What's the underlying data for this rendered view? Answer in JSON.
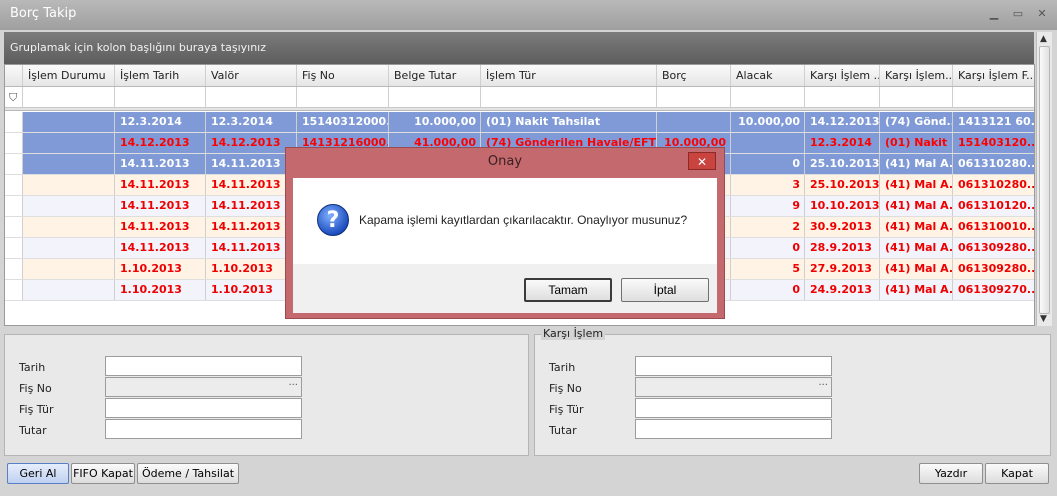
{
  "window": {
    "title": "Borç Takip"
  },
  "grid": {
    "group_hint": "Gruplamak için kolon başlığını buraya taşıyınız",
    "columns": [
      "İşlem Durumu",
      "İşlem Tarih",
      "Valör",
      "Fiş No",
      "Belge Tutar",
      "İşlem Tür",
      "Borç",
      "Alacak",
      "Karşı İşlem ...",
      "Karşı İşlem...",
      "Karşı İşlem F..."
    ],
    "row_indicator": "›",
    "rows": [
      [
        "",
        "12.3.2014",
        "12.3.2014",
        "15140312000...",
        "10.000,00",
        "(01) Nakit Tahsilat",
        "",
        "10.000,00",
        "14.12.2013",
        "(74) Gönd...",
        "1413121 60..."
      ],
      [
        "",
        "14.12.2013",
        "14.12.2013",
        "14131216000...",
        "41.000,00",
        "(74) Gönderilen Havale/EFT",
        "10.000,00",
        "",
        "12.3.2014",
        "(01) Nakit ...",
        "151403120..."
      ],
      [
        "",
        "14.11.2013",
        "14.11.2013",
        "",
        "",
        "",
        "",
        "0",
        "25.10.2013",
        "(41) Mal A...",
        "061310280..."
      ],
      [
        "",
        "14.11.2013",
        "14.11.2013",
        "",
        "",
        "",
        "",
        "3",
        "25.10.2013",
        "(41) Mal A...",
        "061310280..."
      ],
      [
        "",
        "14.11.2013",
        "14.11.2013",
        "",
        "",
        "",
        "",
        "9",
        "10.10.2013",
        "(41) Mal A...",
        "061310120..."
      ],
      [
        "",
        "14.11.2013",
        "14.11.2013",
        "",
        "",
        "",
        "",
        "2",
        "30.9.2013",
        "(41) Mal A...",
        "061310010..."
      ],
      [
        "",
        "14.11.2013",
        "14.11.2013",
        "",
        "",
        "",
        "",
        "0",
        "28.9.2013",
        "(41) Mal A...",
        "061309280..."
      ],
      [
        "",
        "1.10.2013",
        "1.10.2013",
        "",
        "",
        "",
        "",
        "5",
        "27.9.2013",
        "(41) Mal A...",
        "061309280..."
      ],
      [
        "",
        "1.10.2013",
        "1.10.2013",
        "",
        "",
        "",
        "",
        "0",
        "24.9.2013",
        "(41) Mal A...",
        "061309270..."
      ]
    ]
  },
  "left_form": {
    "labels": {
      "tarih": "Tarih",
      "fis_no": "Fiş No",
      "fis_tur": "Fiş Tür",
      "tutar": "Tutar"
    },
    "ellipsis": "···"
  },
  "right_form": {
    "legend": "Karşı İşlem",
    "labels": {
      "tarih": "Tarih",
      "fis_no": "Fiş No",
      "fis_tur": "Fiş Tür",
      "tutar": "Tutar"
    },
    "ellipsis": "···"
  },
  "buttons": {
    "geri_al": "Geri Al",
    "fifo_kapat": "FIFO Kapat",
    "odeme_tahsilat": "Ödeme / Tahsilat",
    "yazdir": "Yazdır",
    "kapat": "Kapat"
  },
  "dialog": {
    "title": "Onay",
    "close_glyph": "✕",
    "icon_glyph": "?",
    "message": "Kapama işlemi kayıtlardan çıkarılacaktır. Onaylıyor musunuz?",
    "ok": "Tamam",
    "cancel": "İptal"
  }
}
